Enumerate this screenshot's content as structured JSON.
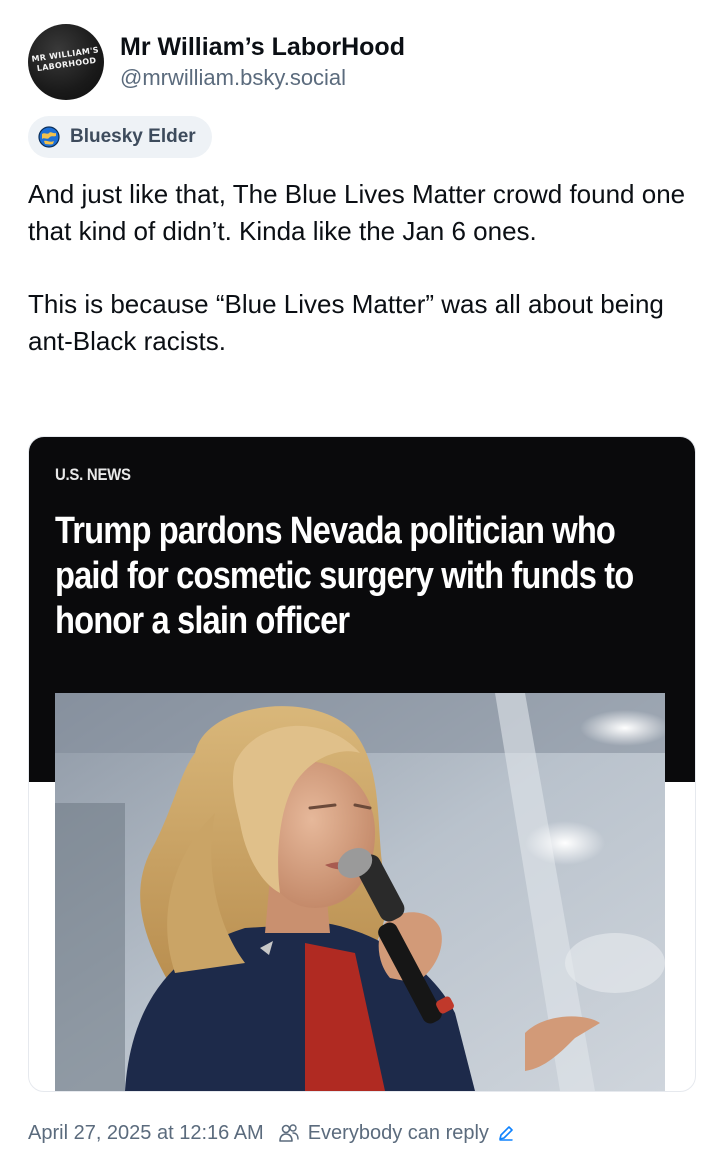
{
  "author": {
    "display_name": "Mr William’s LaborHood",
    "handle": "@mrwilliam.bsky.social",
    "avatar_icon": "avatar-logo",
    "avatar_text_line1": "MR WILLIAM'S",
    "avatar_text_line2": "LABORHOOD"
  },
  "badge": {
    "icon": "globe-icon",
    "label": "Bluesky Elder"
  },
  "post": {
    "paragraph1": "And just like that, The Blue Lives Matter crowd found one that kind of didn’t. Kinda like the Jan 6 ones.",
    "paragraph2": "This is because “Blue Lives Matter” was all about being ant-Black racists."
  },
  "embed": {
    "section": "U.S. NEWS",
    "headline": "Trump pardons Nevada politician who paid for cosmetic surgery with funds to honor a slain officer",
    "image_subject": "woman-speaking-into-microphone"
  },
  "footer": {
    "timestamp": "April 27, 2025 at 12:16 AM",
    "reply_icon": "people-icon",
    "reply_setting": "Everybody can reply",
    "edit_icon": "pencil-icon"
  },
  "colors": {
    "text": "#0b0f14",
    "muted": "#5b6b7d",
    "badge_bg": "#eef2f6",
    "embed_dark": "#0a0a0c",
    "link_blue": "#1083fe"
  }
}
